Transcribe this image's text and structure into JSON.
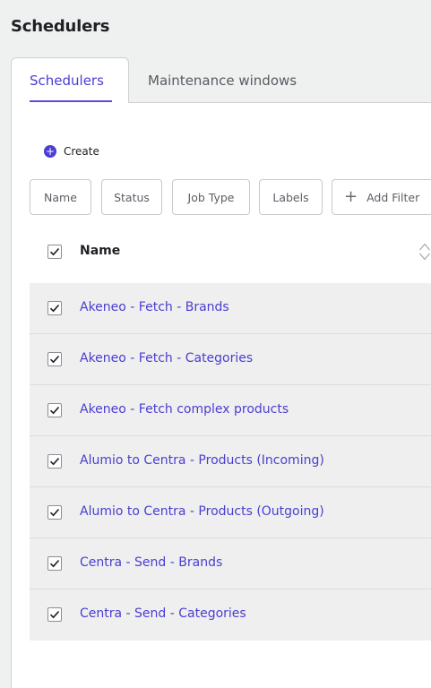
{
  "page": {
    "title": "Schedulers"
  },
  "tabs": [
    {
      "label": "Schedulers",
      "active": true
    },
    {
      "label": "Maintenance windows",
      "active": false
    }
  ],
  "toolbar": {
    "create_label": "Create"
  },
  "filters": [
    "Name",
    "Status",
    "Job Type",
    "Labels",
    "Add Filter"
  ],
  "table": {
    "header_name": "Name",
    "rows": [
      "Akeneo - Fetch - Brands",
      "Akeneo - Fetch - Categories",
      "Akeneo - Fetch complex products",
      "Alumio to Centra - Products (Incoming)",
      "Alumio to Centra - Products (Outgoing)",
      "Centra - Send - Brands",
      "Centra - Send - Categories"
    ]
  },
  "colors": {
    "accent": "#4a3ed1",
    "row_bg": "#efefef",
    "page_bg": "#eff0f0"
  },
  "icons": [
    "plus-circle-icon",
    "plus-icon",
    "sort-icon",
    "check-icon"
  ]
}
